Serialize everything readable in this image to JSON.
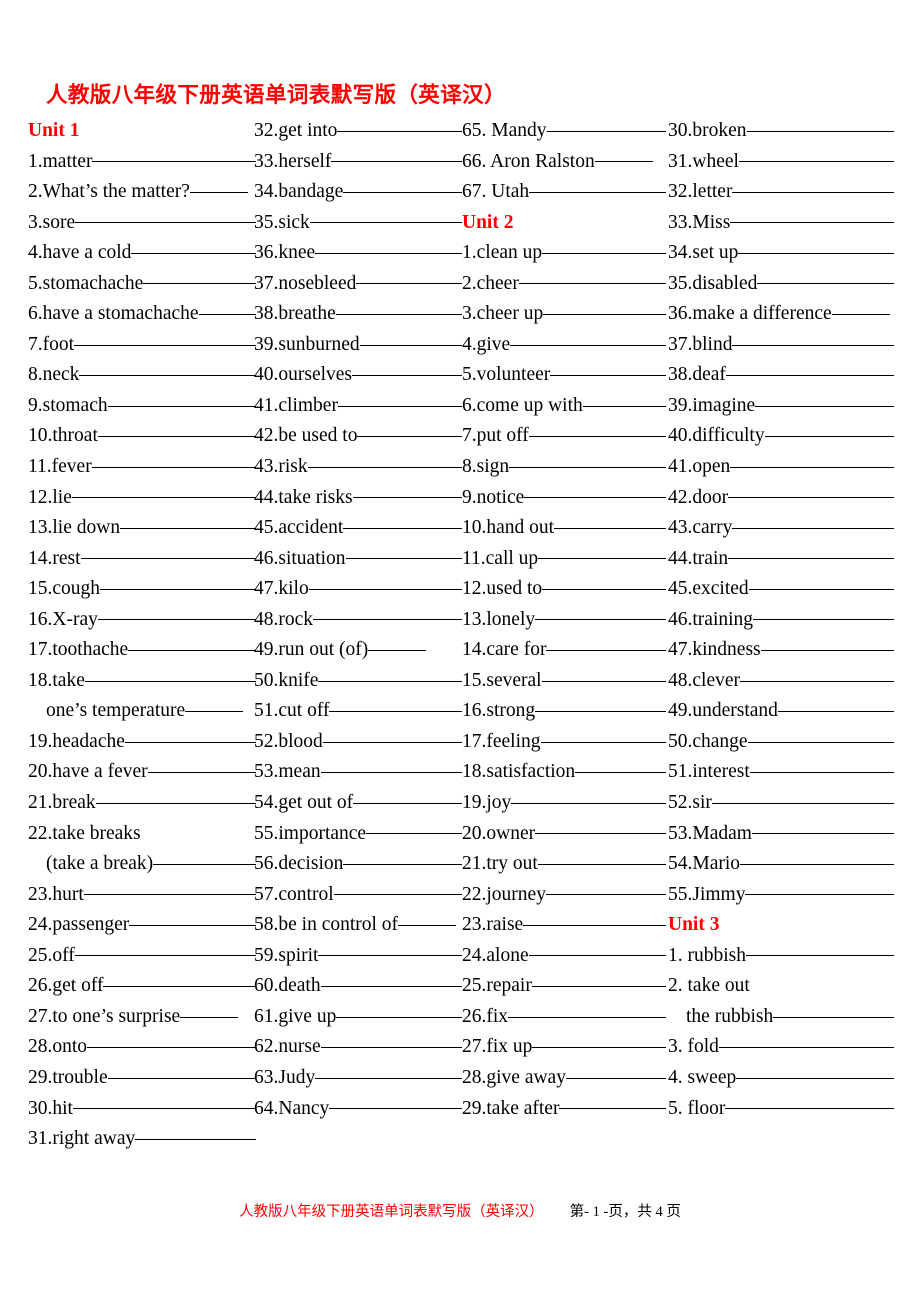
{
  "document": {
    "title": "人教版八年级下册英语单词表默写版（英译汉）"
  },
  "footer": {
    "title": "人教版八年级下册英语单词表默写版（英译汉）",
    "page_label": "第- 1 -页，共 4 页"
  },
  "colors": {
    "heading_red": "#ff0000",
    "body_black": "#000000",
    "background": "#ffffff"
  },
  "columns": [
    {
      "id": "column-1",
      "rows": [
        {
          "type": "unit",
          "label": "Unit 1"
        },
        {
          "type": "entry",
          "label": "1.matter"
        },
        {
          "type": "entry",
          "label": "2.What’s the matter?",
          "blank": "short"
        },
        {
          "type": "entry",
          "label": "3.sore"
        },
        {
          "type": "entry",
          "label": "4.have a cold"
        },
        {
          "type": "entry",
          "label": "5.stomachache"
        },
        {
          "type": "entry",
          "label": "6.have a stomachache",
          "blank": "short"
        },
        {
          "type": "entry",
          "label": "7.foot"
        },
        {
          "type": "entry",
          "label": "8.neck"
        },
        {
          "type": "entry",
          "label": "9.stomach"
        },
        {
          "type": "entry",
          "label": "10.throat"
        },
        {
          "type": "entry",
          "label": "11.fever"
        },
        {
          "type": "entry",
          "label": "12.lie"
        },
        {
          "type": "entry",
          "label": "13.lie down"
        },
        {
          "type": "entry",
          "label": "14.rest"
        },
        {
          "type": "entry",
          "label": "15.cough"
        },
        {
          "type": "entry",
          "label": "16.X-ray"
        },
        {
          "type": "entry",
          "label": "17.toothache"
        },
        {
          "type": "entry",
          "label": "18.take "
        },
        {
          "type": "continuation",
          "label": "one’s temperature",
          "blank": "short"
        },
        {
          "type": "entry",
          "label": "19.headache"
        },
        {
          "type": "entry",
          "label": "20.have a fever"
        },
        {
          "type": "entry",
          "label": "21.break"
        },
        {
          "type": "entry",
          "label": "22.take breaks",
          "blank": "none"
        },
        {
          "type": "continuation",
          "label": "(take a break)"
        },
        {
          "type": "entry",
          "label": "23.hurt"
        },
        {
          "type": "entry",
          "label": "24.passenger"
        },
        {
          "type": "entry",
          "label": "25.off"
        },
        {
          "type": "entry",
          "label": "26.get off"
        },
        {
          "type": "entry",
          "label": "27.to one’s surprise",
          "blank": "short"
        },
        {
          "type": "entry",
          "label": "28.onto"
        },
        {
          "type": "entry",
          "label": "29.trouble"
        },
        {
          "type": "entry",
          "label": "30.hit"
        },
        {
          "type": "entry",
          "label": "31.right away"
        }
      ]
    },
    {
      "id": "column-2",
      "rows": [
        {
          "type": "entry",
          "label": "32.get into"
        },
        {
          "type": "entry",
          "label": "33.herself"
        },
        {
          "type": "entry",
          "label": "34.bandage"
        },
        {
          "type": "entry",
          "label": "35.sick"
        },
        {
          "type": "entry",
          "label": "36.knee"
        },
        {
          "type": "entry",
          "label": "37.nosebleed"
        },
        {
          "type": "entry",
          "label": "38.breathe"
        },
        {
          "type": "entry",
          "label": "39.sunburned"
        },
        {
          "type": "entry",
          "label": "40.ourselves"
        },
        {
          "type": "entry",
          "label": "41.climber"
        },
        {
          "type": "entry",
          "label": "42.be used to"
        },
        {
          "type": "entry",
          "label": "43.risk"
        },
        {
          "type": "entry",
          "label": "44.take risks"
        },
        {
          "type": "entry",
          "label": "45.accident"
        },
        {
          "type": "entry",
          "label": "46.situation"
        },
        {
          "type": "entry",
          "label": "47.kilo"
        },
        {
          "type": "entry",
          "label": "48.rock"
        },
        {
          "type": "entry",
          "label": "49.run out (of)",
          "blank": "short"
        },
        {
          "type": "entry",
          "label": "50.knife"
        },
        {
          "type": "entry",
          "label": "51.cut off"
        },
        {
          "type": "entry",
          "label": "52.blood"
        },
        {
          "type": "entry",
          "label": "53.mean"
        },
        {
          "type": "entry",
          "label": "54.get out of"
        },
        {
          "type": "entry",
          "label": "55.importance"
        },
        {
          "type": "entry",
          "label": "56.decision"
        },
        {
          "type": "entry",
          "label": "57.control"
        },
        {
          "type": "entry",
          "label": "58.be in control of",
          "blank": "short"
        },
        {
          "type": "entry",
          "label": "59.spirit"
        },
        {
          "type": "entry",
          "label": "60.death"
        },
        {
          "type": "entry",
          "label": "61.give up"
        },
        {
          "type": "entry",
          "label": "62.nurse"
        },
        {
          "type": "entry",
          "label": "63.Judy"
        },
        {
          "type": "entry",
          "label": "64.Nancy"
        }
      ]
    },
    {
      "id": "column-3",
      "rows": [
        {
          "type": "entry",
          "label": "65.  Mandy"
        },
        {
          "type": "entry",
          "label": "66.  Aron Ralston",
          "blank": "short"
        },
        {
          "type": "entry",
          "label": "67.  Utah"
        },
        {
          "type": "unit",
          "label": "Unit 2"
        },
        {
          "type": "entry",
          "label": "1.clean up"
        },
        {
          "type": "entry",
          "label": "2.cheer"
        },
        {
          "type": "entry",
          "label": "3.cheer up"
        },
        {
          "type": "entry",
          "label": "4.give "
        },
        {
          "type": "entry",
          "label": "5.volunteer"
        },
        {
          "type": "entry",
          "label": "6.come up with"
        },
        {
          "type": "entry",
          "label": "7.put off"
        },
        {
          "type": "entry",
          "label": "8.sign"
        },
        {
          "type": "entry",
          "label": "9.notice"
        },
        {
          "type": "entry",
          "label": "10.hand out"
        },
        {
          "type": "entry",
          "label": "11.call up"
        },
        {
          "type": "entry",
          "label": "12.used to"
        },
        {
          "type": "entry",
          "label": "13.lonely"
        },
        {
          "type": "entry",
          "label": "14.care for"
        },
        {
          "type": "entry",
          "label": "15.several"
        },
        {
          "type": "entry",
          "label": "16.strong"
        },
        {
          "type": "entry",
          "label": "17.feeling"
        },
        {
          "type": "entry",
          "label": "18.satisfaction"
        },
        {
          "type": "entry",
          "label": "19.joy"
        },
        {
          "type": "entry",
          "label": "20.owner"
        },
        {
          "type": "entry",
          "label": "21.try out"
        },
        {
          "type": "entry",
          "label": "22.journey"
        },
        {
          "type": "entry",
          "label": "23.raise"
        },
        {
          "type": "entry",
          "label": "24.alone"
        },
        {
          "type": "entry",
          "label": "25.repair"
        },
        {
          "type": "entry",
          "label": "26.fix"
        },
        {
          "type": "entry",
          "label": "27.fix up"
        },
        {
          "type": "entry",
          "label": "28.give away"
        },
        {
          "type": "entry",
          "label": "29.take after"
        }
      ]
    },
    {
      "id": "column-4",
      "rows": [
        {
          "type": "entry",
          "label": "30.broken"
        },
        {
          "type": "entry",
          "label": "31.wheel"
        },
        {
          "type": "entry",
          "label": "32.letter"
        },
        {
          "type": "entry",
          "label": "33.Miss"
        },
        {
          "type": "entry",
          "label": "34.set up"
        },
        {
          "type": "entry",
          "label": "35.disabled"
        },
        {
          "type": "entry",
          "label": "36.make a difference",
          "blank": "short"
        },
        {
          "type": "entry",
          "label": "37.blind "
        },
        {
          "type": "entry",
          "label": "38.deaf"
        },
        {
          "type": "entry",
          "label": "39.imagine"
        },
        {
          "type": "entry",
          "label": "40.difficulty"
        },
        {
          "type": "entry",
          "label": "41.open"
        },
        {
          "type": "entry",
          "label": "42.door"
        },
        {
          "type": "entry",
          "label": "43.carry"
        },
        {
          "type": "entry",
          "label": "44.train"
        },
        {
          "type": "entry",
          "label": "45.excited"
        },
        {
          "type": "entry",
          "label": "46.training"
        },
        {
          "type": "entry",
          "label": "47.kindness"
        },
        {
          "type": "entry",
          "label": "48.clever"
        },
        {
          "type": "entry",
          "label": "49.understand"
        },
        {
          "type": "entry",
          "label": "50.change"
        },
        {
          "type": "entry",
          "label": "51.interest"
        },
        {
          "type": "entry",
          "label": "52.sir"
        },
        {
          "type": "entry",
          "label": "53.Madam"
        },
        {
          "type": "entry",
          "label": "54.Mario"
        },
        {
          "type": "entry",
          "label": "55.Jimmy"
        },
        {
          "type": "unit",
          "label": "Unit 3"
        },
        {
          "type": "entry",
          "label": "1.  rubbish"
        },
        {
          "type": "entry",
          "label": "2.  take out",
          "blank": "none"
        },
        {
          "type": "continuation",
          "label": "the rubbish"
        },
        {
          "type": "entry",
          "label": "3.  fold"
        },
        {
          "type": "entry",
          "label": "4.  sweep"
        },
        {
          "type": "entry",
          "label": "5.  floor"
        }
      ]
    }
  ]
}
